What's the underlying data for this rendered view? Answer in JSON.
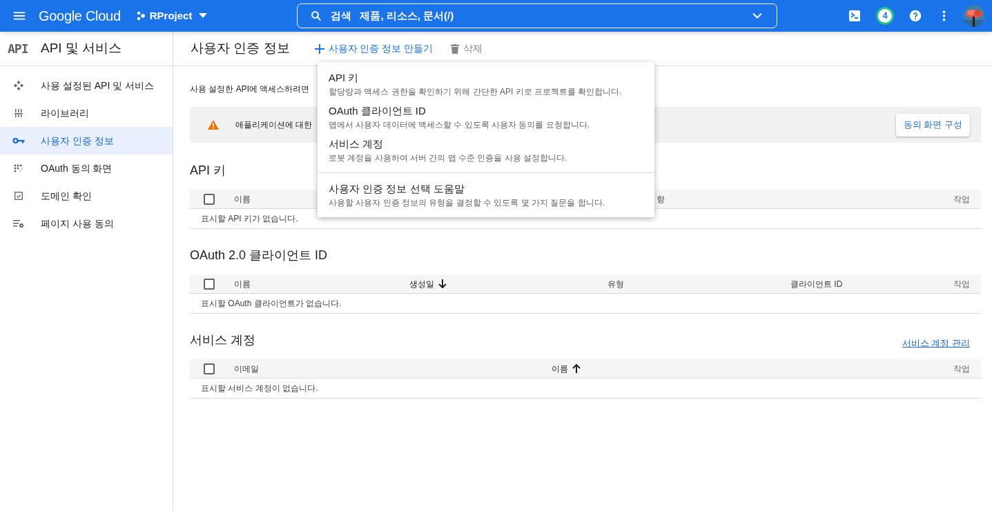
{
  "header": {
    "logo": "Google Cloud",
    "project": "RProject",
    "search_label": "검색",
    "search_placeholder": "제품, 리소스, 문서(/)",
    "notification_count": "4"
  },
  "sidebar": {
    "logo": "API",
    "title": "API 및 서비스",
    "items": [
      {
        "label": "사용 설정된 API 및 서비스",
        "selected": false
      },
      {
        "label": "라이브러리",
        "selected": false
      },
      {
        "label": "사용자 인증 정보",
        "selected": true
      },
      {
        "label": "OAuth 동의 화면",
        "selected": false
      },
      {
        "label": "도메인 확인",
        "selected": false
      },
      {
        "label": "페이지 사용 동의",
        "selected": false
      }
    ]
  },
  "page": {
    "title": "사용자 인증 정보",
    "actions": [
      {
        "label": "사용자 인증 정보 만들기",
        "kind": "create",
        "disabled": false
      },
      {
        "label": "삭제",
        "kind": "delete",
        "disabled": true
      }
    ],
    "info_text": "사용 설정한 API에 액세스하려면",
    "warning": {
      "text": "애플리케이션에 대한",
      "button": "동의 화면 구성"
    },
    "sections": [
      {
        "title": "API 키",
        "select_all_checked": false,
        "columns": [
          {
            "label": "이름",
            "sorted_ascending": false,
            "sorted_descending": false
          },
          {
            "label": "항",
            "sorted_ascending": false,
            "sorted_descending": false
          }
        ],
        "action_column": "작업",
        "empty_text": "표시할 API 키가 없습니다."
      },
      {
        "title": "OAuth 2.0 클라이언트 ID",
        "select_all_checked": false,
        "columns": [
          {
            "label": "이름",
            "sorted_ascending": false,
            "sorted_descending": false
          },
          {
            "label": "생성일",
            "sorted_ascending": false,
            "sorted_descending": true
          },
          {
            "label": "유형",
            "sorted_ascending": false,
            "sorted_descending": false
          },
          {
            "label": "클라이언트 ID",
            "sorted_ascending": false,
            "sorted_descending": false
          }
        ],
        "action_column": "작업",
        "empty_text": "표시할 OAuth 클라이언트가 없습니다."
      },
      {
        "title": "서비스 계정",
        "link": "서비스 계정 관리",
        "select_all_checked": false,
        "columns": [
          {
            "label": "이메일",
            "sorted_ascending": false,
            "sorted_descending": false
          },
          {
            "label": "이름",
            "sorted_ascending": true,
            "sorted_descending": false
          }
        ],
        "action_column": "작업",
        "empty_text": "표시할 서비스 계정이 없습니다."
      }
    ]
  },
  "create_menu": {
    "items": [
      {
        "title": "API 키",
        "description": "할당량과 액세스 권한을 확인하기 위해 간단한 API 키로 프로젝트를 확인합니다.",
        "divider_before": false
      },
      {
        "title": "OAuth 클라이언트 ID",
        "description": "앱에서 사용자 데이터에 액세스할 수 있도록 사용자 동의를 요청합니다.",
        "divider_before": false
      },
      {
        "title": "서비스 계정",
        "description": "로봇 계정을 사용하여 서버 간의 앱 수준 인증을 사용 설정합니다.",
        "divider_before": false
      },
      {
        "title": "사용자 인증 정보 선택 도움말",
        "description": "사용할 사용자 인증 정보의 유형을 결정할 수 있도록 몇 가지 질문을 합니다.",
        "divider_before": true
      }
    ]
  }
}
